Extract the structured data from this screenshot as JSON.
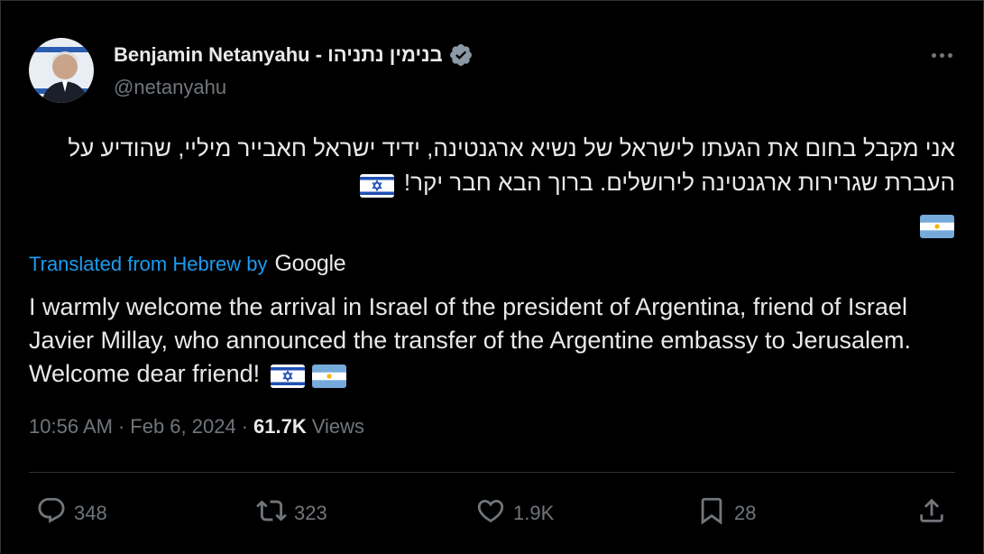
{
  "author": {
    "display_name": "Benjamin Netanyahu - בנימין נתניהו",
    "handle": "@netanyahu",
    "verified_icon": "verified-badge-icon"
  },
  "tweet": {
    "hebrew_text": "אני מקבל בחום את הגעתו לישראל של נשיא ארגנטינה, ידיד ישראל חאבייר מיליי, שהודיע על העברת שגרירות ארגנטינה לירושלים. ברוך הבא חבר יקר!",
    "translated_label": "Translated from Hebrew by",
    "translator": "Google",
    "english_text": "I warmly welcome the arrival in Israel of the president of Argentina, friend of Israel Javier Millay, who announced the transfer of the Argentine embassy to Jerusalem. Welcome dear friend!",
    "flags": [
      "israel-flag",
      "argentina-flag"
    ]
  },
  "meta": {
    "time": "10:56 AM",
    "date": "Feb 6, 2024",
    "views_count": "61.7K",
    "views_label": "Views",
    "separator": "·"
  },
  "actions": {
    "replies": "348",
    "reposts": "323",
    "likes": "1.9K",
    "bookmarks": "28"
  },
  "colors": {
    "background": "#000000",
    "text": "#e7e9ea",
    "secondary": "#71767b",
    "link": "#1d9bf0",
    "border": "#2f3336"
  }
}
